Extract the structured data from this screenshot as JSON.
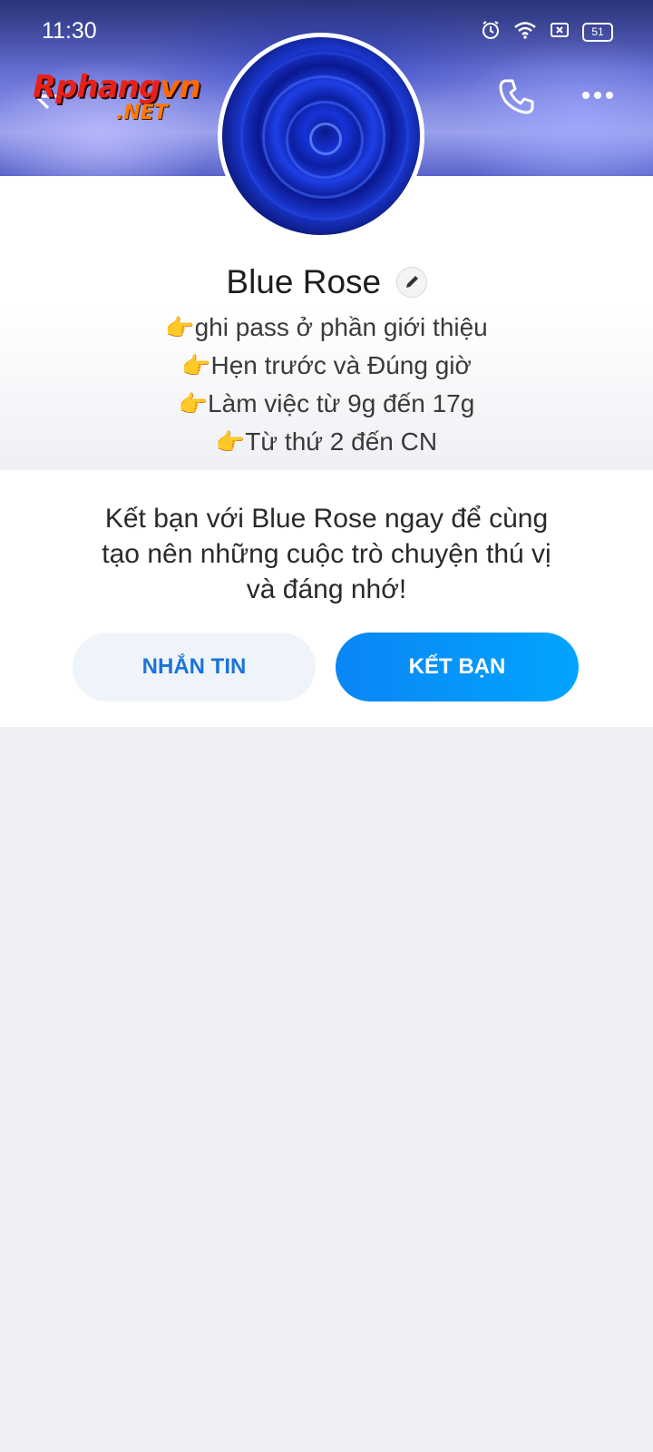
{
  "status_bar": {
    "time": "11:30",
    "battery": "51",
    "icons": [
      "alarm-icon",
      "wifi-icon",
      "sim-x-icon",
      "battery-icon"
    ]
  },
  "header": {
    "logo_main": "Rphangvn",
    "logo_suffix": ".NET",
    "icons": [
      "back-arrow-icon",
      "phone-icon",
      "more-dots-icon"
    ]
  },
  "profile": {
    "name": "Blue Rose",
    "bio": [
      {
        "emoji": "👉",
        "text": "ghi pass ở phần giới thiệu"
      },
      {
        "emoji": "👉",
        "text": "Hẹn trước và Đúng giờ"
      },
      {
        "emoji": "👉",
        "text": "Làm việc từ 9g đến 17g"
      },
      {
        "emoji": "👉",
        "text": "Từ thứ 2 đến CN"
      }
    ]
  },
  "card": {
    "invite_line1": "Kết bạn với Blue Rose ngay để cùng",
    "invite_line2": "tạo nên những cuộc trò chuyện thú vị",
    "invite_line3": "và đáng nhớ!",
    "message_button": "NHẮN TIN",
    "add_friend_button": "KẾT BẠN"
  },
  "colors": {
    "accent": "#0a86f5",
    "message_button_text": "#1a73d9",
    "message_button_bg": "#eef4fa",
    "page_bg": "#eef0f4"
  }
}
